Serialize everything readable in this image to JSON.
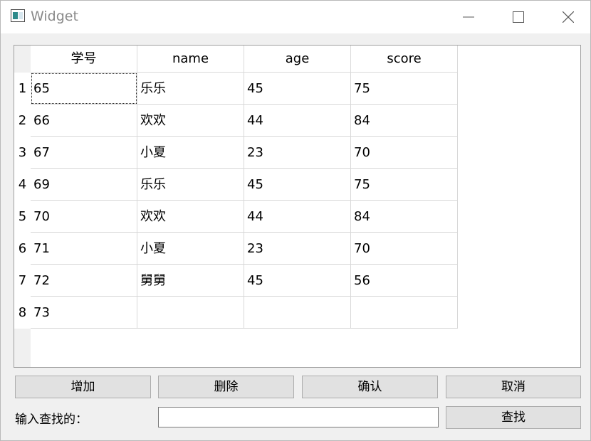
{
  "window": {
    "title": "Widget"
  },
  "table": {
    "columns": [
      "学号",
      "name",
      "age",
      "score"
    ],
    "row_numbers": [
      "1",
      "2",
      "3",
      "4",
      "5",
      "6",
      "7",
      "8"
    ],
    "rows": [
      [
        "65",
        "乐乐",
        "45",
        "75"
      ],
      [
        "66",
        "欢欢",
        "44",
        "84"
      ],
      [
        "67",
        "小夏",
        "23",
        "70"
      ],
      [
        "69",
        "乐乐",
        "45",
        "75"
      ],
      [
        "70",
        "欢欢",
        "44",
        "84"
      ],
      [
        "71",
        "小夏",
        "23",
        "70"
      ],
      [
        "72",
        "舅舅",
        "45",
        "56"
      ],
      [
        "73",
        "",
        "",
        ""
      ]
    ],
    "focused_cell": [
      0,
      0
    ]
  },
  "buttons": {
    "add": "增加",
    "delete": "删除",
    "confirm": "确认",
    "cancel": "取消",
    "find": "查找"
  },
  "search": {
    "label": "输入查找的：",
    "value": "",
    "placeholder": ""
  }
}
